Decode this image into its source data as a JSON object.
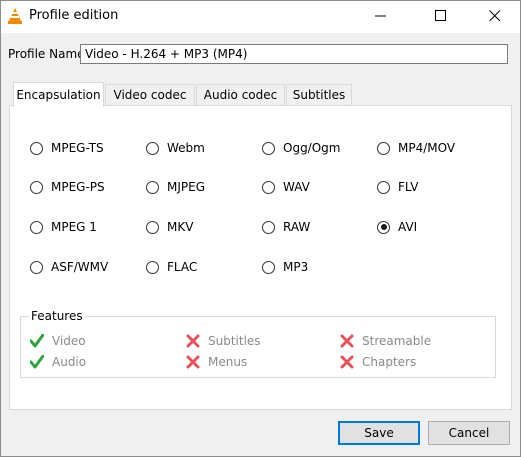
{
  "window": {
    "title": "Profile edition",
    "app_icon": "vlc-cone-icon",
    "controls": [
      "minimize-icon",
      "maximize-icon",
      "close-icon"
    ]
  },
  "profile": {
    "label": "Profile Name",
    "value": "Video - H.264 + MP3 (MP4)"
  },
  "tabs": [
    {
      "label": "Encapsulation",
      "active": true
    },
    {
      "label": "Video codec",
      "active": false
    },
    {
      "label": "Audio codec",
      "active": false
    },
    {
      "label": "Subtitles",
      "active": false
    }
  ],
  "formats": [
    {
      "label": "MPEG-TS",
      "checked": false
    },
    {
      "label": "Webm",
      "checked": false
    },
    {
      "label": "Ogg/Ogm",
      "checked": false
    },
    {
      "label": "MP4/MOV",
      "checked": false
    },
    {
      "label": "MPEG-PS",
      "checked": false
    },
    {
      "label": "MJPEG",
      "checked": false
    },
    {
      "label": "WAV",
      "checked": false
    },
    {
      "label": "FLV",
      "checked": false
    },
    {
      "label": "MPEG 1",
      "checked": false
    },
    {
      "label": "MKV",
      "checked": false
    },
    {
      "label": "RAW",
      "checked": false
    },
    {
      "label": "AVI",
      "checked": true
    },
    {
      "label": "ASF/WMV",
      "checked": false
    },
    {
      "label": "FLAC",
      "checked": false
    },
    {
      "label": "MP3",
      "checked": false
    }
  ],
  "features": {
    "title": "Features",
    "items": [
      {
        "label": "Video",
        "supported": true
      },
      {
        "label": "Subtitles",
        "supported": false
      },
      {
        "label": "Streamable",
        "supported": false
      },
      {
        "label": "Audio",
        "supported": true
      },
      {
        "label": "Menus",
        "supported": false
      },
      {
        "label": "Chapters",
        "supported": false
      }
    ],
    "colors": {
      "supported": "#2ea43a",
      "unsupported": "#e8505a"
    }
  },
  "buttons": {
    "save": "Save",
    "cancel": "Cancel"
  }
}
